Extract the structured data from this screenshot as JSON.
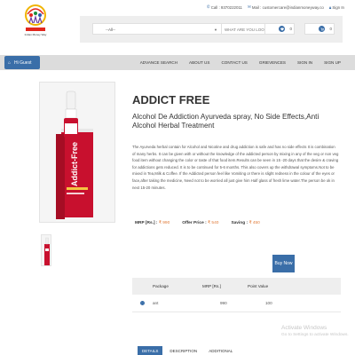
{
  "header": {
    "logo_text": "Indian Money Way",
    "call": "Call : 9370222011",
    "mail": "Mail : customercare@indianmoneyway.co",
    "sign_in": "Sign In"
  },
  "search": {
    "category_selected": "--All--",
    "placeholder": "WHAT ARE YOU LOOKING FOR?",
    "wishlist_count": "0",
    "cart_count": "0"
  },
  "nav": {
    "greeting": "Hi Guest",
    "links": [
      "ADVANCE SEARCH",
      "ABOUT US",
      "CONTACT US",
      "GRIEVENCES",
      "SIGN IN",
      "SIGN UP"
    ]
  },
  "product": {
    "title": "ADDICT FREE",
    "subtitle": "Alcohol De Addiction Ayurveda spray, No Side Effects,Anti Alcohol Herbal Treatment",
    "description": "The Ayurveda herbal contain for Alcohol and Nicotine and drug addiction is safe and has no side effects It is combination of many herbs. It can be given with or without the knowledge of the addicted person by mixing in any of the veg or non veg food item without changing the color or taste of that food item.Results can be seen in 15 -20 days that the desire & craving for addictions gets reduced. It is to be continued for 5-6 months. This also covers up the withdrawal symptoms.Not to be mixed in Tea,Milk & Coffee. If the Addicted person feel like Vomiting or there is slight redness in the colour of the eyes or face,after taking the medicine, Need not to be worried all just give him Half glass of fresh lime water.The person be ok in next 15-20 minutes.",
    "bottle_label": "Addict-Free",
    "mrp_label": "MRP [Rs.] :",
    "mrp": "₹ 990",
    "offer_label": "Offer Price :",
    "offer": "₹ 540",
    "saving_label": "Saving :",
    "saving": "₹ 450",
    "buy_now": "Buy Now"
  },
  "table": {
    "headers": [
      "Package",
      "MRP [Rs.]",
      "Point Value"
    ],
    "rows": [
      {
        "package": "ant",
        "mrp": "990",
        "pv": "100"
      }
    ]
  },
  "watermark": {
    "line1": "Activate Windows",
    "line2": "Go to Settings to activate Windows."
  },
  "tabs": [
    "DETAILS",
    "DESCRIPTION",
    "ADDITIONAL"
  ],
  "colors": {
    "accent": "#3a6ea8",
    "price": "#e07b39",
    "bottle_red": "#c8102e"
  }
}
